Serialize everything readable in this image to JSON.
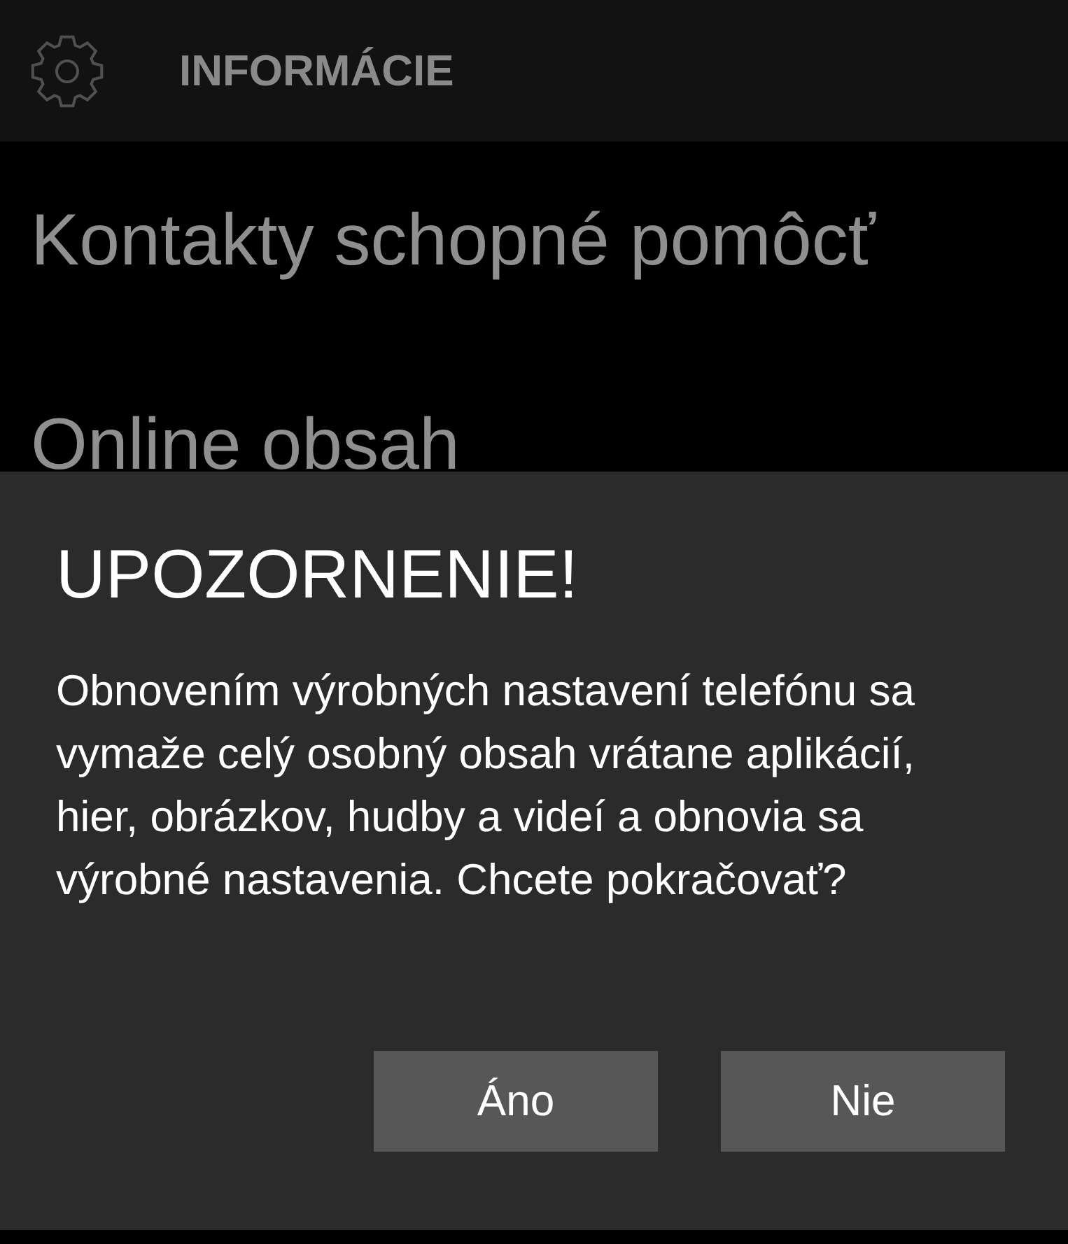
{
  "header": {
    "title": "INFORMÁCIE"
  },
  "settings_list": [
    {
      "label": "Kontakty schopné pomôcť"
    },
    {
      "label": "Online obsah"
    }
  ],
  "dialog": {
    "title": "UPOZORNENIE!",
    "message": "Obnovením výrobných nastavení telefónu sa vymaže celý osobný obsah vrátane aplikácií, hier, obrázkov, hudby a videí a obnovia sa výrobné nastavenia. Chcete pokračovať?",
    "buttons": [
      {
        "label": "Áno"
      },
      {
        "label": "Nie"
      }
    ]
  }
}
